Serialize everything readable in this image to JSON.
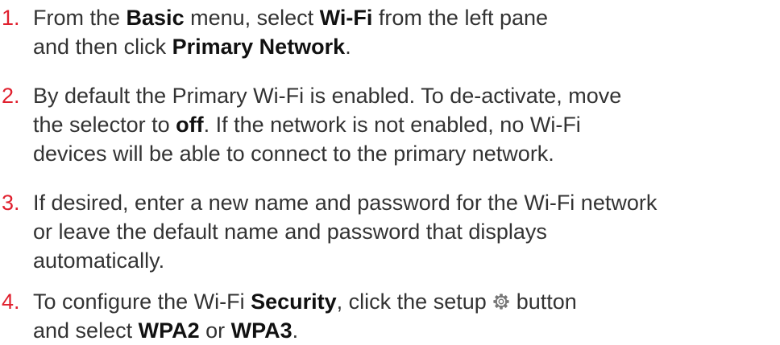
{
  "steps": [
    {
      "number": "1.",
      "parts": [
        {
          "type": "text",
          "value": "From the "
        },
        {
          "type": "bold",
          "value": "Basic"
        },
        {
          "type": "text",
          "value": " menu, select "
        },
        {
          "type": "bold",
          "value": "Wi-Fi"
        },
        {
          "type": "text",
          "value": " from the left pane and then click "
        },
        {
          "type": "bold",
          "value": "Primary Network"
        },
        {
          "type": "text",
          "value": "."
        }
      ]
    },
    {
      "number": "2.",
      "parts": [
        {
          "type": "text",
          "value": "By default the Primary Wi-Fi is enabled. To de-activate, move the selector to "
        },
        {
          "type": "bold",
          "value": "off"
        },
        {
          "type": "text",
          "value": ". If the network is not enabled, no Wi-Fi devices will be able to connect to the primary network."
        }
      ]
    },
    {
      "number": "3.",
      "parts": [
        {
          "type": "text",
          "value": "If desired, enter a new name and password for the Wi-Fi network or leave the default name and password that displays automatically."
        }
      ]
    },
    {
      "number": "4.",
      "parts": [
        {
          "type": "text",
          "value": "To configure the Wi-Fi "
        },
        {
          "type": "bold",
          "value": "Security"
        },
        {
          "type": "text",
          "value": ", click the setup "
        },
        {
          "type": "icon",
          "value": "gear-icon"
        },
        {
          "type": "text",
          "value": " button and select "
        },
        {
          "type": "bold",
          "value": "WPA2"
        },
        {
          "type": "text",
          "value": " or "
        },
        {
          "type": "bold",
          "value": "WPA3"
        },
        {
          "type": "text",
          "value": "."
        }
      ]
    }
  ],
  "colors": {
    "number": "#e0202e",
    "body_text": "#333333",
    "bold_text": "#111111",
    "icon": "#777777"
  }
}
